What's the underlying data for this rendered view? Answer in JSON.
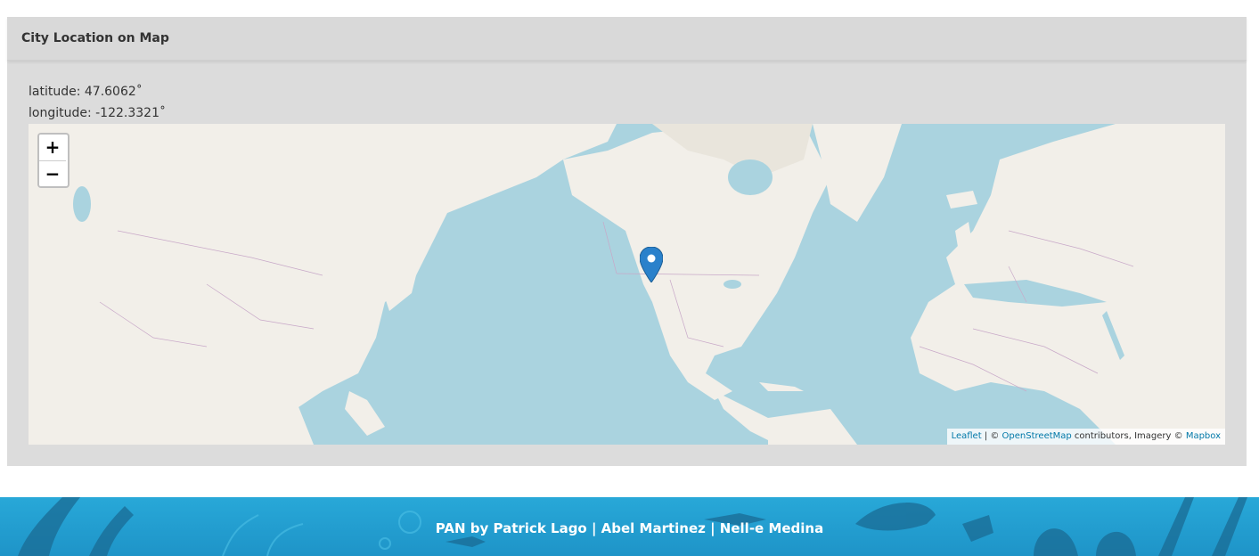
{
  "card": {
    "title": "City Location on Map",
    "latitude": "latitude: 47.6062˚",
    "longitude": "longitude: -122.3321˚"
  },
  "map": {
    "zoom_in": "+",
    "zoom_out": "−",
    "attribution": {
      "leaflet": "Leaflet",
      "sep": " | © ",
      "osm": "OpenStreetMap",
      "mid": " contributors, Imagery © ",
      "mapbox": "Mapbox"
    },
    "marker_icon": "map-pin-icon",
    "colors": {
      "water": "#aad3df",
      "land": "#f2efe9",
      "marker": "#2a81cb"
    }
  },
  "footer": {
    "credits": "PAN by Patrick Lago | Abel Martinez | Nell-e Medina"
  }
}
